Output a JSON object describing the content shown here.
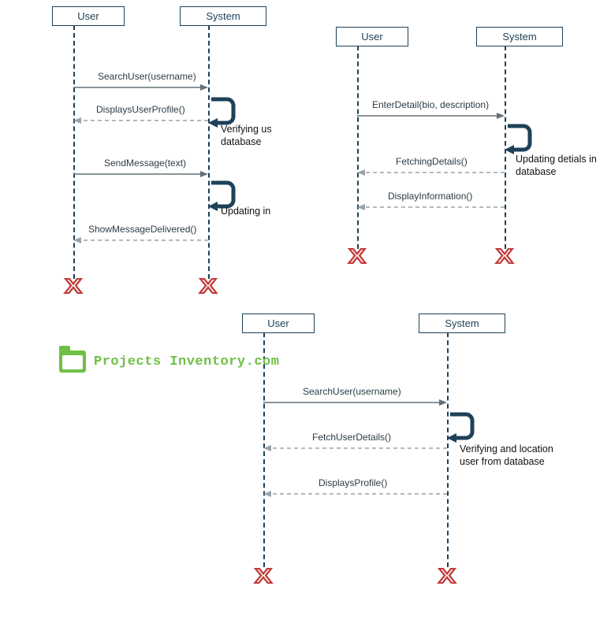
{
  "participants": {
    "user": "User",
    "system": "System"
  },
  "diagram1": {
    "messages": {
      "m1": "SearchUser(username)",
      "m2": "DisplaysUserProfile()",
      "m3": "SendMessage(text)",
      "m4": "ShowMessageDelivered()"
    },
    "notes": {
      "n1": "Verifying us\ndatabase",
      "n2": "Updating in"
    }
  },
  "diagram2": {
    "messages": {
      "m1": "EnterDetail(bio, description)",
      "m2": "FetchingDetails()",
      "m3": "DisplayInformation()"
    },
    "notes": {
      "n1": "Updating detials in database"
    }
  },
  "diagram3": {
    "messages": {
      "m1": "SearchUser(username)",
      "m2": "FetchUserDetails()",
      "m3": "DisplaysProfile()"
    },
    "notes": {
      "n1": "Verifying and location user from database"
    }
  },
  "watermark": "Projects Inventory.com"
}
